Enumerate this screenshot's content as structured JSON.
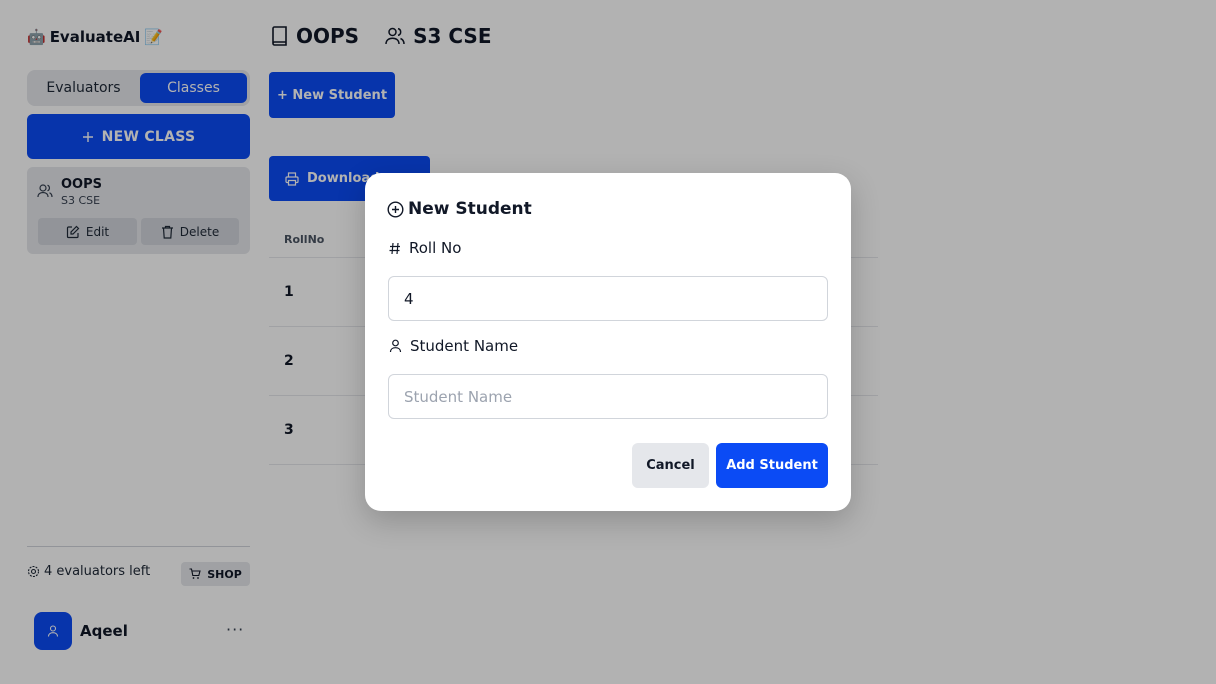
{
  "sidebar": {
    "brand": {
      "robot_emoji": "🤖",
      "name": "EvaluateAI",
      "memo_emoji": "📝"
    },
    "tabs": [
      {
        "label": "Evaluators",
        "active": false
      },
      {
        "label": "Classes",
        "active": true
      }
    ],
    "new_class_label": "NEW CLASS",
    "class_card": {
      "name": "OOPS",
      "subtitle": "S3 CSE",
      "edit_label": "Edit",
      "delete_label": "Delete"
    },
    "evaluators_left": "4 evaluators left",
    "shop_label": "SHOP",
    "user": {
      "name": "Aqeel"
    },
    "more_label": "···"
  },
  "main": {
    "class_name": "OOPS",
    "section": "S3 CSE",
    "new_student_label": "+ New Student",
    "download_label": "Download",
    "table": {
      "header": "RollNo",
      "rows": [
        "1",
        "2",
        "3"
      ]
    }
  },
  "modal": {
    "title": "New Student",
    "roll_label": "Roll No",
    "roll_value": "4",
    "name_label": "Student Name",
    "name_placeholder": "Student Name",
    "cancel_label": "Cancel",
    "add_label": "Add Student"
  },
  "colors": {
    "accent": "#0b4bf5",
    "overlay": "rgba(0,0,0,0.30)"
  }
}
